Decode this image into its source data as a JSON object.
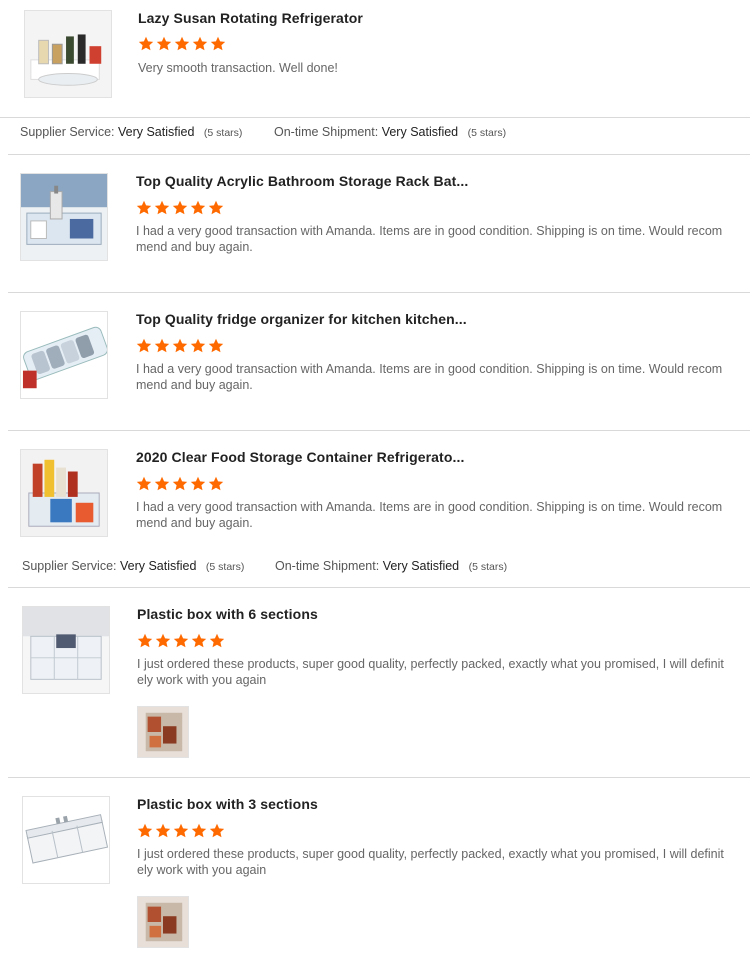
{
  "reviews": [
    {
      "product_title": "Lazy Susan Rotating Refrigerator",
      "rating": 5,
      "comment": "Very smooth transaction. Well done!"
    },
    {
      "product_title": "Top Quality Acrylic Bathroom Storage Rack Bat...",
      "rating": 5,
      "comment": "I had a very good transaction with Amanda. Items are in good condition. Shipping is on time. Would recommend and buy again."
    },
    {
      "product_title": "Top Quality fridge organizer for kitchen kitchen...",
      "rating": 5,
      "comment": "I had a very good transaction with Amanda. Items are in good condition. Shipping is on time. Would recommend and buy again."
    },
    {
      "product_title": "2020 Clear Food Storage Container Refrigerato...",
      "rating": 5,
      "comment": "I had a very good transaction with Amanda. Items are in good condition. Shipping is on time. Would recommend and buy again."
    },
    {
      "product_title": "Plastic box with 6 sections",
      "rating": 5,
      "comment": "I just ordered these products, super good quality, perfectly packed, exactly what you promised, I will definitely work with you again"
    },
    {
      "product_title": "Plastic box with 3 sections",
      "rating": 5,
      "comment": "I just ordered these products, super good quality, perfectly packed, exactly what you promised, I will definitely work with you again"
    }
  ],
  "service_summary_1": {
    "supplier_label": "Supplier Service:",
    "supplier_value": "Very Satisfied",
    "supplier_stars": "(5 stars)",
    "shipment_label": "On-time Shipment:",
    "shipment_value": "Very Satisfied",
    "shipment_stars": "(5 stars)"
  },
  "service_summary_2": {
    "supplier_label": "Supplier Service:",
    "supplier_value": "Very Satisfied",
    "supplier_stars": "(5 stars)",
    "shipment_label": "On-time Shipment:",
    "shipment_value": "Very Satisfied",
    "shipment_stars": "(5 stars)"
  },
  "colors": {
    "star": "#ff6a00",
    "divider": "#d9d9d9",
    "title": "#222222",
    "comment": "#666666"
  },
  "icons": {
    "rating_star": "star-icon"
  }
}
